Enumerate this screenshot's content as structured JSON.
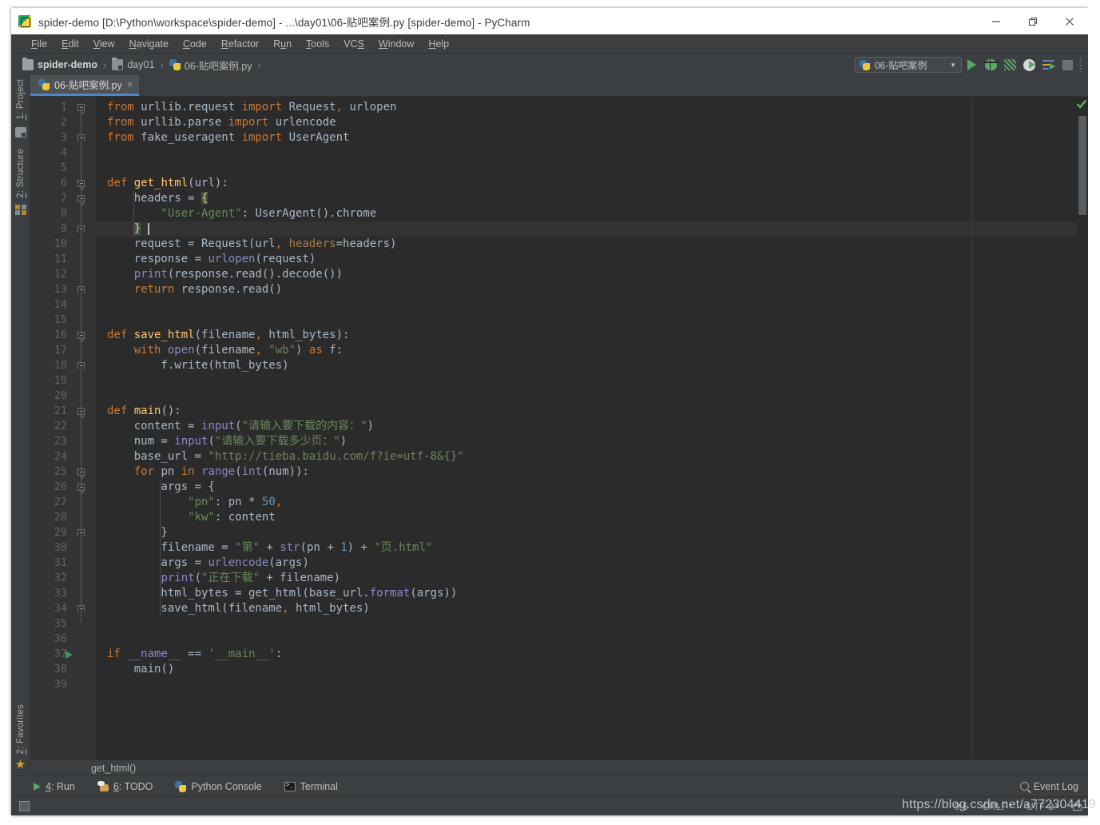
{
  "window": {
    "title": "spider-demo [D:\\Python\\workspace\\spider-demo] - ...\\day01\\06-贴吧案例.py [spider-demo] - PyCharm",
    "app_icon": "pycharm-icon",
    "controls": {
      "minimize": "minimize-icon",
      "restore": "restore-icon",
      "close": "close-icon"
    }
  },
  "menubar": {
    "items": [
      {
        "label": "File",
        "mnemonic": "F"
      },
      {
        "label": "Edit",
        "mnemonic": "E"
      },
      {
        "label": "View",
        "mnemonic": "V"
      },
      {
        "label": "Navigate",
        "mnemonic": "N"
      },
      {
        "label": "Code",
        "mnemonic": "C"
      },
      {
        "label": "Refactor",
        "mnemonic": "R"
      },
      {
        "label": "Run",
        "mnemonic": "u"
      },
      {
        "label": "Tools",
        "mnemonic": "T"
      },
      {
        "label": "VCS",
        "mnemonic": "S"
      },
      {
        "label": "Window",
        "mnemonic": "W"
      },
      {
        "label": "Help",
        "mnemonic": "H"
      }
    ]
  },
  "breadcrumb": {
    "items": [
      {
        "label": "spider-demo",
        "icon": "folder-icon"
      },
      {
        "label": "day01",
        "icon": "folder-icon"
      },
      {
        "label": "06-贴吧案例.py",
        "icon": "python-file-icon"
      }
    ],
    "separator": "›"
  },
  "run_toolbar": {
    "config_name": "06-贴吧案例",
    "config_icon": "python-file-icon",
    "dropdown_caret": "▼",
    "buttons": [
      {
        "name": "run-button",
        "icon": "run-icon"
      },
      {
        "name": "debug-button",
        "icon": "debug-icon"
      },
      {
        "name": "run-coverage-button",
        "icon": "coverage-icon"
      },
      {
        "name": "profile-button",
        "icon": "profile-icon"
      },
      {
        "name": "attach-button",
        "icon": "attach-icon"
      },
      {
        "name": "stop-button",
        "icon": "stop-icon"
      }
    ]
  },
  "left_strip": {
    "top": [
      {
        "label": "1: Project",
        "mnemonic": "1",
        "icon": "project-icon"
      },
      {
        "label": "2: Structure",
        "mnemonic": "2",
        "icon": "structure-icon"
      }
    ],
    "bottom": [
      {
        "label": "2: Favorites",
        "mnemonic": "2",
        "icon": "star-icon"
      }
    ]
  },
  "editor_tab": {
    "label": "06-贴吧案例.py",
    "icon": "python-file-icon",
    "close": "×"
  },
  "editor": {
    "breadcrumb_text": "get_html()",
    "inspection_status": "ok-check-icon",
    "current_line": 9,
    "run_marker_line": 37,
    "total_lines": 39,
    "lines": [
      {
        "n": 1,
        "text": "from urllib.request import Request, urlopen"
      },
      {
        "n": 2,
        "text": "from urllib.parse import urlencode"
      },
      {
        "n": 3,
        "text": "from fake_useragent import UserAgent"
      },
      {
        "n": 4,
        "text": ""
      },
      {
        "n": 5,
        "text": ""
      },
      {
        "n": 6,
        "text": "def get_html(url):"
      },
      {
        "n": 7,
        "text": "    headers = {"
      },
      {
        "n": 8,
        "text": "        \"User-Agent\": UserAgent().chrome"
      },
      {
        "n": 9,
        "text": "    }"
      },
      {
        "n": 10,
        "text": "    request = Request(url, headers=headers)"
      },
      {
        "n": 11,
        "text": "    response = urlopen(request)"
      },
      {
        "n": 12,
        "text": "    print(response.read().decode())"
      },
      {
        "n": 13,
        "text": "    return response.read()"
      },
      {
        "n": 14,
        "text": ""
      },
      {
        "n": 15,
        "text": ""
      },
      {
        "n": 16,
        "text": "def save_html(filename, html_bytes):"
      },
      {
        "n": 17,
        "text": "    with open(filename, \"wb\") as f:"
      },
      {
        "n": 18,
        "text": "        f.write(html_bytes)"
      },
      {
        "n": 19,
        "text": ""
      },
      {
        "n": 20,
        "text": ""
      },
      {
        "n": 21,
        "text": "def main():"
      },
      {
        "n": 22,
        "text": "    content = input(\"请输入要下载的内容：\")"
      },
      {
        "n": 23,
        "text": "    num = input(\"请输入要下载多少页：\")"
      },
      {
        "n": 24,
        "text": "    base_url = \"http://tieba.baidu.com/f?ie=utf-8&{}\""
      },
      {
        "n": 25,
        "text": "    for pn in range(int(num)):"
      },
      {
        "n": 26,
        "text": "        args = {"
      },
      {
        "n": 27,
        "text": "            \"pn\": pn * 50,"
      },
      {
        "n": 28,
        "text": "            \"kw\": content"
      },
      {
        "n": 29,
        "text": "        }"
      },
      {
        "n": 30,
        "text": "        filename = \"第\" + str(pn + 1) + \"页.html\""
      },
      {
        "n": 31,
        "text": "        args = urlencode(args)"
      },
      {
        "n": 32,
        "text": "        print(\"正在下载\" + filename)"
      },
      {
        "n": 33,
        "text": "        html_bytes = get_html(base_url.format(args))"
      },
      {
        "n": 34,
        "text": "        save_html(filename, html_bytes)"
      },
      {
        "n": 35,
        "text": ""
      },
      {
        "n": 36,
        "text": ""
      },
      {
        "n": 37,
        "text": "if __name__ == '__main__':"
      },
      {
        "n": 38,
        "text": "    main()"
      },
      {
        "n": 39,
        "text": ""
      }
    ]
  },
  "tool_windows": {
    "items": [
      {
        "label": "4: Run",
        "mnemonic": "4",
        "icon": "run-icon"
      },
      {
        "label": "6: TODO",
        "mnemonic": "6",
        "icon": "todo-icon"
      },
      {
        "label": "Python Console",
        "icon": "python-console-icon"
      },
      {
        "label": "Terminal",
        "icon": "terminal-icon"
      }
    ],
    "event_log": {
      "label": "Event Log",
      "icon": "magnifier-icon"
    }
  },
  "statusbar": {
    "toggle_icon": "toggle-toolwindows-icon",
    "caret_position": "9:6",
    "line_separator": "CRLF",
    "encoding": "UTF-8",
    "lock_icon": "lock-icon"
  },
  "watermark": {
    "text": "https://blog.csdn.net/a772304419"
  },
  "colors": {
    "window_chrome": "#3c3f41",
    "editor_bg": "#2b2b2b",
    "gutter_bg": "#313335",
    "current_line_bg": "#323232",
    "tab_active_bg": "#4e5254",
    "tab_underline": "#4a88c7",
    "keyword": "#cc7832",
    "string": "#6a8759",
    "function": "#ffc66d",
    "number": "#6897bb",
    "builtin": "#8888c6",
    "default_text": "#a9b7c6",
    "accent_green": "#59a869"
  }
}
